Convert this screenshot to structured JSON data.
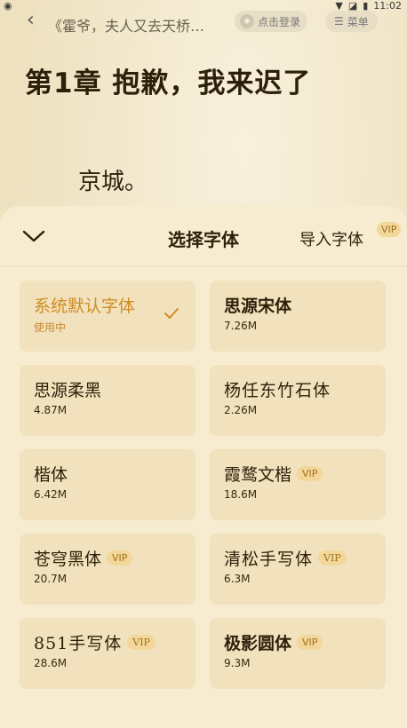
{
  "status": {
    "time": "11:02"
  },
  "header": {
    "book_title": "《霍爷，夫人又去天桥…",
    "login_label": "点击登录",
    "menu_label": "菜单"
  },
  "reader": {
    "chapter_title": "第1章 抱歉，我来迟了",
    "paragraph": "京城。"
  },
  "font_sheet": {
    "title": "选择字体",
    "import_label": "导入字体",
    "import_badge": "VIP",
    "fonts": [
      {
        "name": "系统默认字体",
        "sub": "使用中",
        "selected": true,
        "vip": ""
      },
      {
        "name": "思源宋体",
        "sub": "7.26M",
        "selected": false,
        "vip": ""
      },
      {
        "name": "思源柔黑",
        "sub": "4.87M",
        "selected": false,
        "vip": ""
      },
      {
        "name": "杨任东竹石体",
        "sub": "2.26M",
        "selected": false,
        "vip": ""
      },
      {
        "name": "楷体",
        "sub": "6.42M",
        "selected": false,
        "vip": ""
      },
      {
        "name": "霞鹜文楷",
        "sub": "18.6M",
        "selected": false,
        "vip": "VIP"
      },
      {
        "name": "苍穹黑体",
        "sub": "20.7M",
        "selected": false,
        "vip": "VIP"
      },
      {
        "name": "清松手写体",
        "sub": "6.3M",
        "selected": false,
        "vip": "VIP"
      },
      {
        "name": "851手写体",
        "sub": "28.6M",
        "selected": false,
        "vip": "VIP"
      },
      {
        "name": "极影圆体",
        "sub": "9.3M",
        "selected": false,
        "vip": "VIP"
      }
    ]
  },
  "colors": {
    "accent": "#d08c22",
    "sheet_bg": "#f7ecd0",
    "card_bg": "#f1e1bc"
  }
}
